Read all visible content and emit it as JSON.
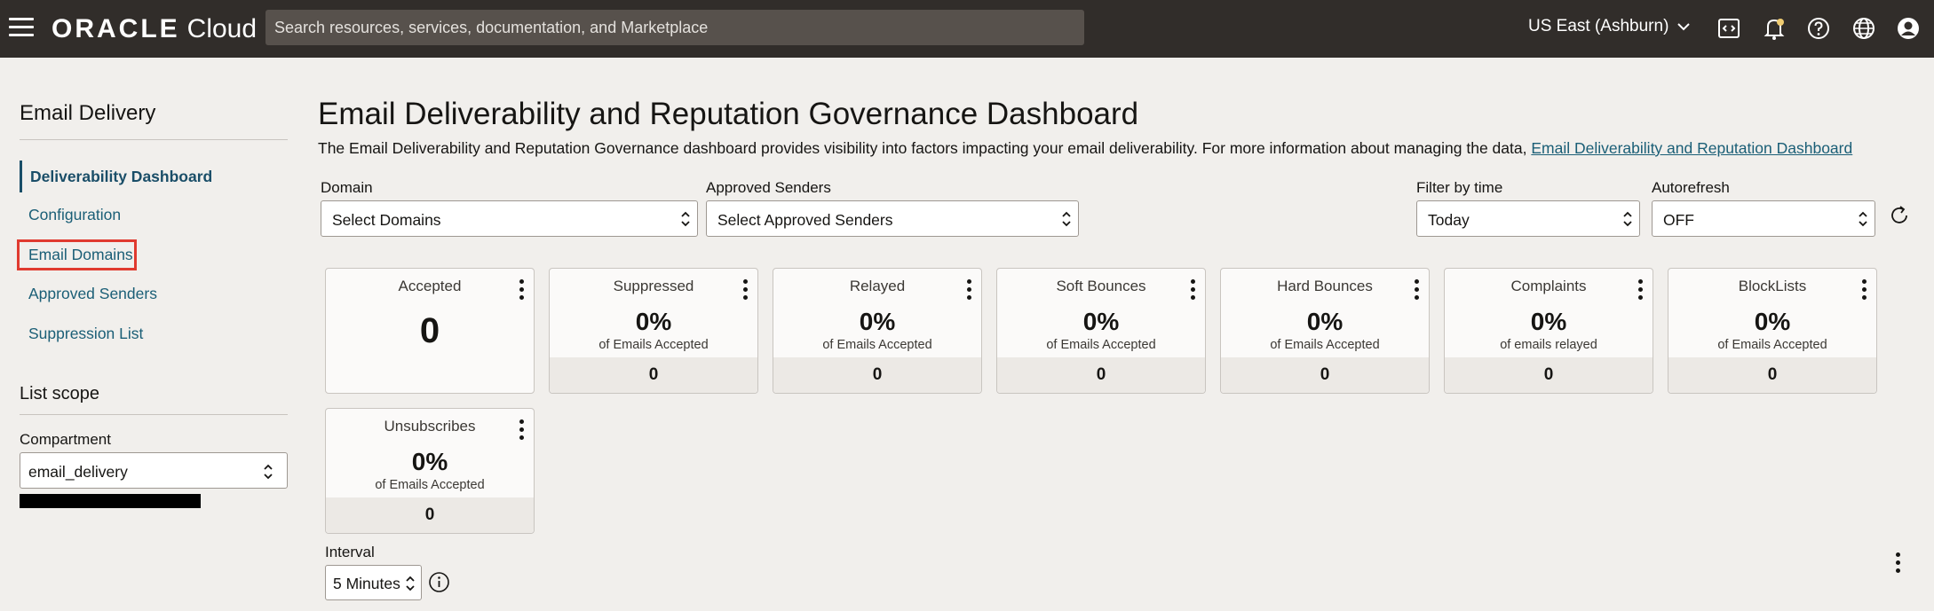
{
  "topbar": {
    "logo_brand": "ORACLE",
    "logo_product": "Cloud",
    "search_placeholder": "Search resources, services, documentation, and Marketplace",
    "region": "US East (Ashburn)"
  },
  "sidebar": {
    "title": "Email Delivery",
    "items": [
      {
        "label": "Deliverability Dashboard"
      },
      {
        "label": "Configuration"
      },
      {
        "label": "Email Domains"
      },
      {
        "label": "Approved Senders"
      },
      {
        "label": "Suppression List"
      }
    ],
    "list_scope": "List scope",
    "compartment_label": "Compartment",
    "compartment_value": "email_delivery"
  },
  "main": {
    "title": "Email Deliverability and Reputation Governance Dashboard",
    "description": "The Email Deliverability and Reputation Governance dashboard provides visibility into factors impacting your email deliverability. For more information about managing the data,",
    "description_link": "Email Deliverability and Reputation Dashboard",
    "filters": {
      "domain_label": "Domain",
      "domain_value": "Select Domains",
      "senders_label": "Approved Senders",
      "senders_value": "Select Approved Senders",
      "time_label": "Filter by time",
      "time_value": "Today",
      "autorefresh_label": "Autorefresh",
      "autorefresh_value": "OFF"
    },
    "cards": [
      {
        "title": "Accepted",
        "value": "0"
      },
      {
        "title": "Suppressed",
        "pct": "0%",
        "sub": "of Emails Accepted",
        "count": "0"
      },
      {
        "title": "Relayed",
        "pct": "0%",
        "sub": "of Emails Accepted",
        "count": "0"
      },
      {
        "title": "Soft Bounces",
        "pct": "0%",
        "sub": "of Emails Accepted",
        "count": "0"
      },
      {
        "title": "Hard Bounces",
        "pct": "0%",
        "sub": "of Emails Accepted",
        "count": "0"
      },
      {
        "title": "Complaints",
        "pct": "0%",
        "sub": "of emails relayed",
        "count": "0"
      },
      {
        "title": "BlockLists",
        "pct": "0%",
        "sub": "of Emails Accepted",
        "count": "0"
      },
      {
        "title": "Unsubscribes",
        "pct": "0%",
        "sub": "of Emails Accepted",
        "count": "0"
      }
    ],
    "interval_label": "Interval",
    "interval_value": "5 Minutes"
  },
  "colors": {
    "topbar": "#312d2a",
    "link": "#1a5e76",
    "highlight": "#e03a2f",
    "background": "#f1efec"
  }
}
